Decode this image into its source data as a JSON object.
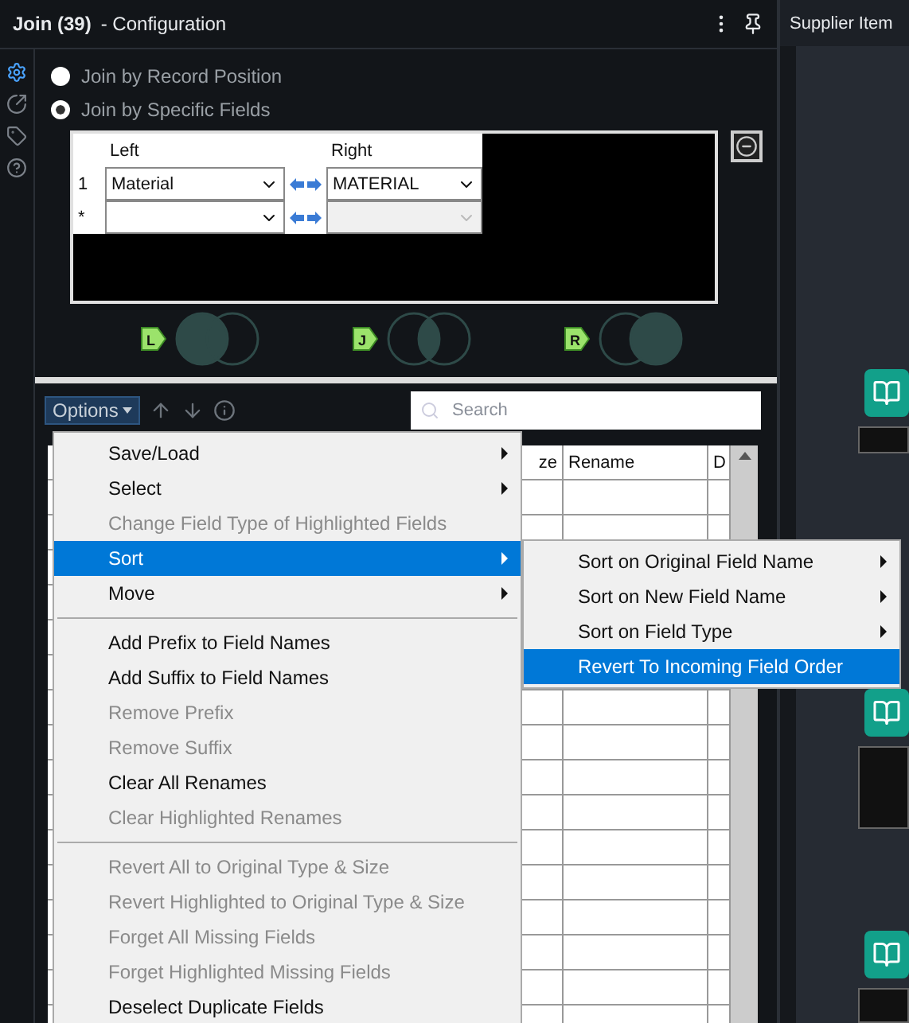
{
  "panel": {
    "tool": "Join (39)",
    "title": "- Configuration"
  },
  "join_modes": [
    {
      "label": "Join by Record Position",
      "selected": false
    },
    {
      "label": "Join by Specific Fields",
      "selected": true
    }
  ],
  "join_table": {
    "columns": [
      "Left",
      "Right"
    ],
    "rows": [
      {
        "index": "1",
        "left": "Material",
        "right": "MATERIAL",
        "right_disabled": false
      },
      {
        "index": "*",
        "right_disabled": true
      }
    ]
  },
  "venn": [
    {
      "label": "L",
      "kind": "left"
    },
    {
      "label": "J",
      "kind": "inner"
    },
    {
      "label": "R",
      "kind": "right"
    }
  ],
  "toolbar": {
    "options": "Options",
    "search_placeholder": "Search"
  },
  "field_table": {
    "columns": [
      "ze",
      "Rename",
      "D"
    ]
  },
  "menu": [
    {
      "kind": "item",
      "label": "Save/Load",
      "disabled": false,
      "submenu": true,
      "selected": false
    },
    {
      "kind": "item",
      "label": "Select",
      "disabled": false,
      "submenu": true,
      "selected": false
    },
    {
      "kind": "item",
      "label": "Change Field Type of Highlighted Fields",
      "disabled": true,
      "submenu": false,
      "selected": false
    },
    {
      "kind": "item",
      "label": "Sort",
      "disabled": false,
      "submenu": true,
      "selected": true
    },
    {
      "kind": "item",
      "label": "Move",
      "disabled": false,
      "submenu": true,
      "selected": false
    },
    {
      "kind": "separator"
    },
    {
      "kind": "item",
      "label": "Add Prefix to Field Names",
      "disabled": false,
      "submenu": false,
      "selected": false
    },
    {
      "kind": "item",
      "label": "Add Suffix to Field Names",
      "disabled": false,
      "submenu": false,
      "selected": false
    },
    {
      "kind": "item",
      "label": "Remove Prefix",
      "disabled": true,
      "submenu": false,
      "selected": false
    },
    {
      "kind": "item",
      "label": "Remove Suffix",
      "disabled": true,
      "submenu": false,
      "selected": false
    },
    {
      "kind": "item",
      "label": "Clear All Renames",
      "disabled": false,
      "submenu": false,
      "selected": false
    },
    {
      "kind": "item",
      "label": "Clear Highlighted Renames",
      "disabled": true,
      "submenu": false,
      "selected": false
    },
    {
      "kind": "separator"
    },
    {
      "kind": "item",
      "label": "Revert All to Original Type & Size",
      "disabled": true,
      "submenu": false,
      "selected": false
    },
    {
      "kind": "item",
      "label": "Revert Highlighted to Original Type & Size",
      "disabled": true,
      "submenu": false,
      "selected": false
    },
    {
      "kind": "item",
      "label": "Forget All Missing Fields",
      "disabled": true,
      "submenu": false,
      "selected": false
    },
    {
      "kind": "item",
      "label": "Forget Highlighted Missing Fields",
      "disabled": true,
      "submenu": false,
      "selected": false
    },
    {
      "kind": "item",
      "label": "Deselect Duplicate Fields",
      "disabled": false,
      "submenu": false,
      "selected": false
    }
  ],
  "submenu": [
    {
      "label": "Sort on Original Field Name",
      "submenu": true,
      "selected": false
    },
    {
      "label": "Sort on New Field Name",
      "submenu": true,
      "selected": false
    },
    {
      "label": "Sort on Field Type",
      "submenu": true,
      "selected": false
    },
    {
      "label": "Revert To Incoming Field Order",
      "submenu": false,
      "selected": true
    }
  ],
  "canvas": {
    "title": "Supplier Item"
  }
}
